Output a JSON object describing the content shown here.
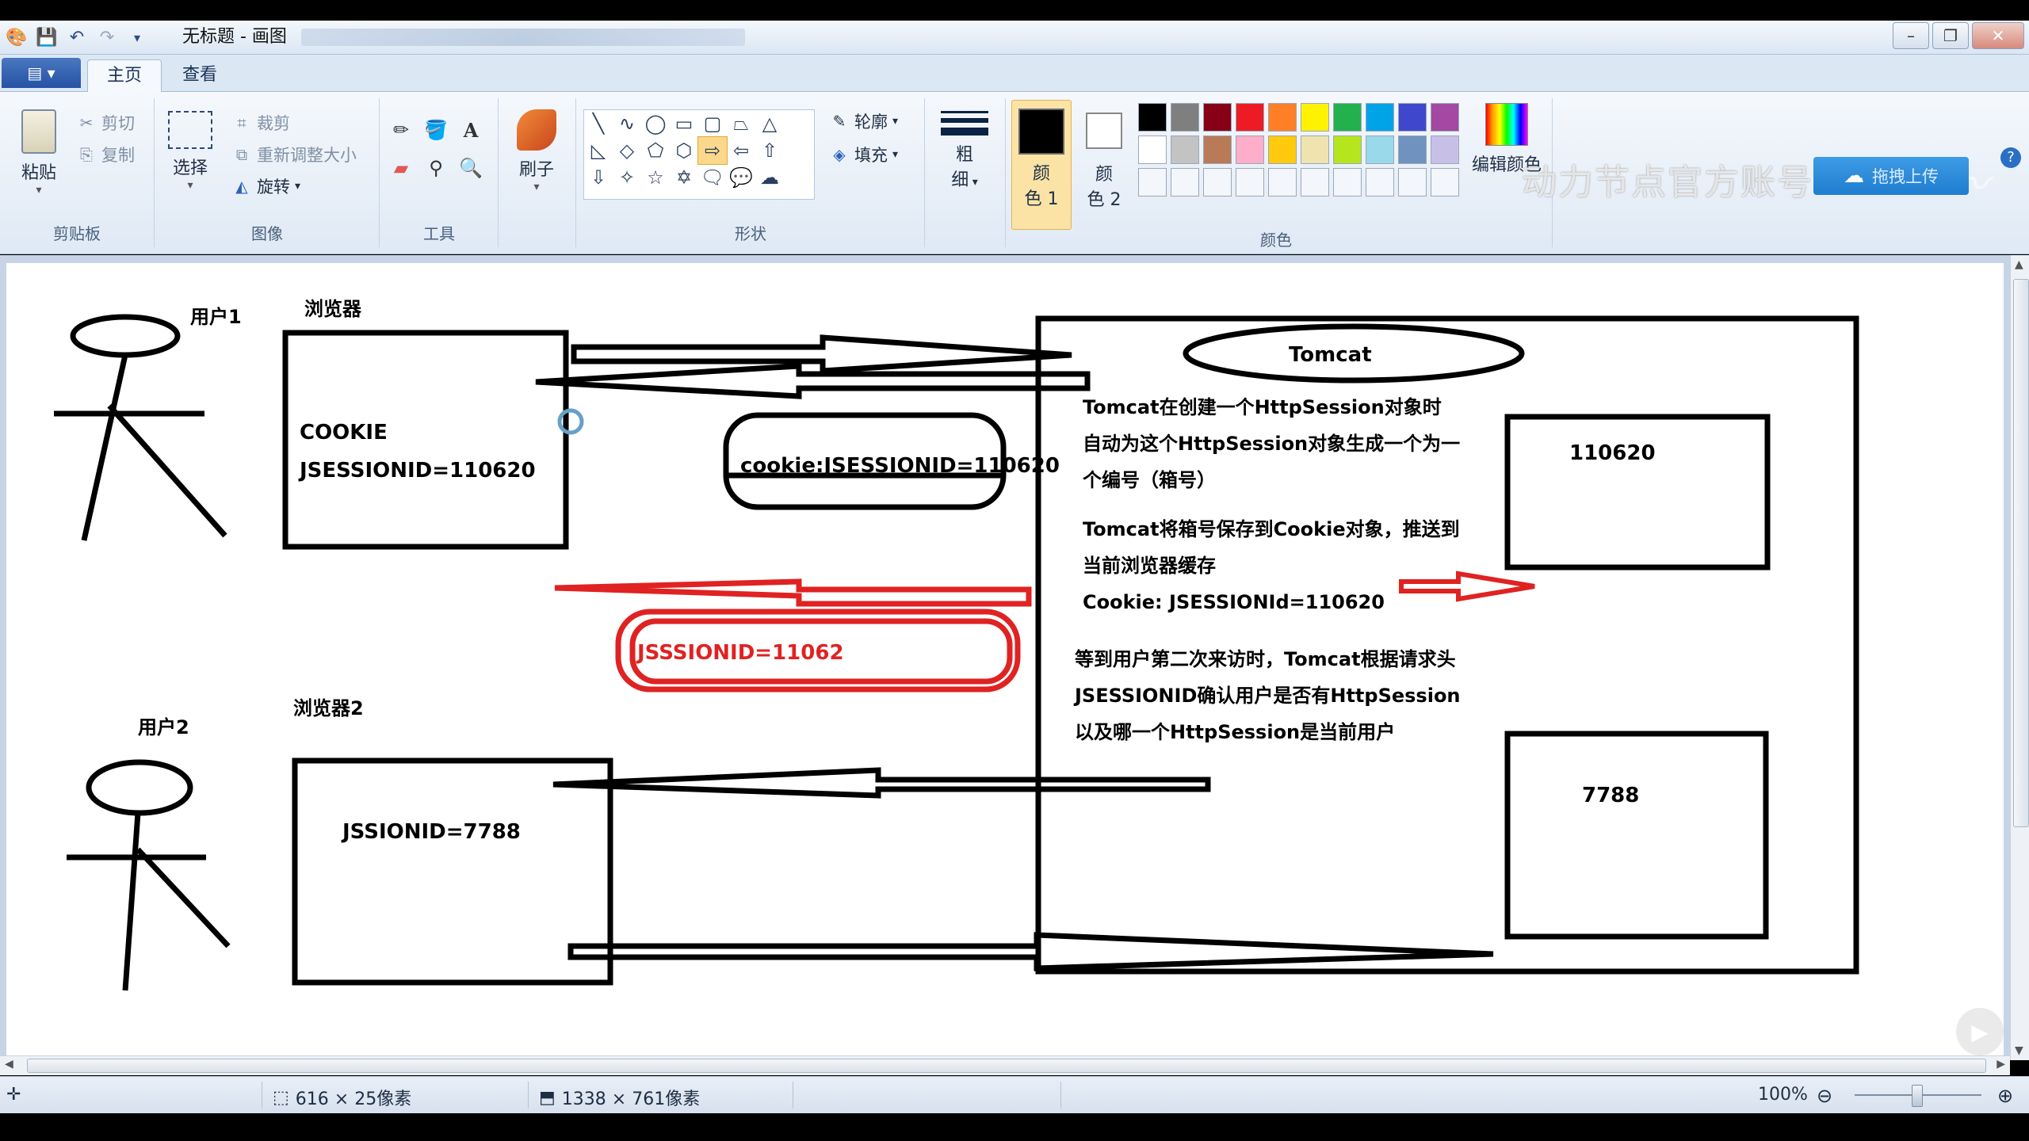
{
  "window": {
    "title": "无标题 - 画图",
    "controls": {
      "minimize": "–",
      "maximize": "❐",
      "close": "✕"
    }
  },
  "tabs": {
    "file": "▤ ▾",
    "home": "主页",
    "view": "查看"
  },
  "ribbon": {
    "clipboard": {
      "paste": "粘贴",
      "cut": "剪切",
      "copy": "复制",
      "label": "剪贴板"
    },
    "image": {
      "select": "选择",
      "crop": "裁剪",
      "resize": "重新调整大小",
      "rotate": "旋转",
      "label": "图像"
    },
    "tools": {
      "label": "工具"
    },
    "brushes": {
      "label": "刷子"
    },
    "shapes": {
      "outline": "轮廓",
      "fill": "填充",
      "label": "形状"
    },
    "size": {
      "label_line1": "粗",
      "label_line2": "细"
    },
    "color1": {
      "line1": "颜",
      "line2": "色 1"
    },
    "color2": {
      "line1": "颜",
      "line2": "色 2"
    },
    "edit_colors": "编辑颜色",
    "colors_label": "颜色",
    "palette_row1": [
      "#000000",
      "#7f7f7f",
      "#880015",
      "#ed1c24",
      "#ff7f27",
      "#fff200",
      "#22b14c",
      "#00a2e8",
      "#3f48cc",
      "#a349a4"
    ],
    "palette_row2": [
      "#ffffff",
      "#c3c3c3",
      "#b97a57",
      "#ffaec9",
      "#ffc90e",
      "#efe4b0",
      "#b5e61d",
      "#99d9ea",
      "#7092be",
      "#c8bfe7"
    ]
  },
  "overlay": {
    "upload_button": "拖拽上传",
    "watermark": "动力节点官方账号"
  },
  "drawing": {
    "user1": "用户1",
    "browser1": "浏览器",
    "cookie_title": "COOKIE",
    "cookie_value": "JSESSIONID=110620",
    "cookie_capsule": "cookie:JSESSIONID=110620",
    "red_capsule": "JSSSIONID=11062",
    "user2": "用户2",
    "browser2": "浏览器2",
    "browser2_value": "JSSIONID=7788",
    "tomcat": "Tomcat",
    "text_lines": [
      "Tomcat在创建一个HttpSession对象时",
      "自动为这个HttpSession对象生成一个为一",
      "个编号（箱号）",
      "Tomcat将箱号保存到Cookie对象，推送到",
      "当前浏览器缓存",
      "Cookie: JSESSIONId=110620",
      "等到用户第二次来访时，Tomcat根据请求头",
      "JSESSIONID确认用户是否有HttpSession",
      "以及哪一个HttpSession是当前用户"
    ],
    "box1": "110620",
    "box2": "7788"
  },
  "statusbar": {
    "selection_size": "616 × 25像素",
    "image_size": "1338 × 761像素",
    "zoom": "100%"
  }
}
